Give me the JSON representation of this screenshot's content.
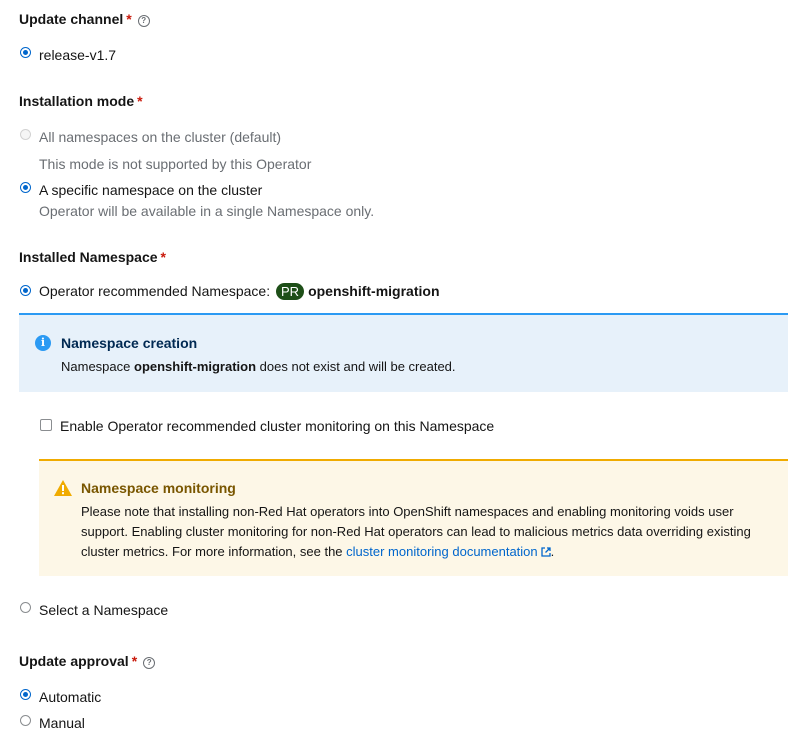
{
  "update_channel": {
    "title": "Update channel",
    "required_mark": "*",
    "help_icon": "help-icon",
    "options": [
      {
        "label": "release-v1.7",
        "checked": true
      }
    ]
  },
  "installation_mode": {
    "title": "Installation mode",
    "required_mark": "*",
    "options": [
      {
        "label": "All namespaces on the cluster (default)",
        "description": "This mode is not supported by this Operator",
        "checked": false,
        "disabled": true
      },
      {
        "label": "A specific namespace on the cluster",
        "description": "Operator will be available in a single Namespace only.",
        "checked": true,
        "disabled": false
      }
    ]
  },
  "installed_namespace": {
    "title": "Installed Namespace",
    "required_mark": "*",
    "recommended": {
      "label": "Operator recommended Namespace:",
      "badge": "PR",
      "namespace": "openshift-migration",
      "checked": true
    },
    "info_alert": {
      "title": "Namespace creation",
      "body_prefix": "Namespace",
      "body_namespace": "openshift-migration",
      "body_suffix": "does not exist and will be created."
    },
    "monitoring_checkbox": {
      "label": "Enable Operator recommended cluster monitoring on this Namespace",
      "checked": false
    },
    "warning_alert": {
      "title": "Namespace monitoring",
      "line1": "Please note that installing non-Red Hat operators into OpenShift namespaces and enabling monitoring voids user",
      "line2": "support. Enabling cluster monitoring for non-Red Hat operators can lead to malicious metrics data overriding existing",
      "line3_prefix": "cluster metrics. For more information, see the",
      "link_text": "cluster monitoring documentation",
      "line3_suffix": "."
    },
    "select_option": {
      "label": "Select a Namespace",
      "checked": false
    }
  },
  "update_approval": {
    "title": "Update approval",
    "required_mark": "*",
    "options": [
      {
        "label": "Automatic",
        "checked": true
      },
      {
        "label": "Manual",
        "checked": false
      }
    ]
  },
  "colors": {
    "primary": "#0066cc",
    "required": "#c9190b",
    "info_bg": "#e7f1fa",
    "warning_bg": "#fdf7e7",
    "warning_border": "#f0ab00",
    "badge_bg": "#1e4f18"
  }
}
